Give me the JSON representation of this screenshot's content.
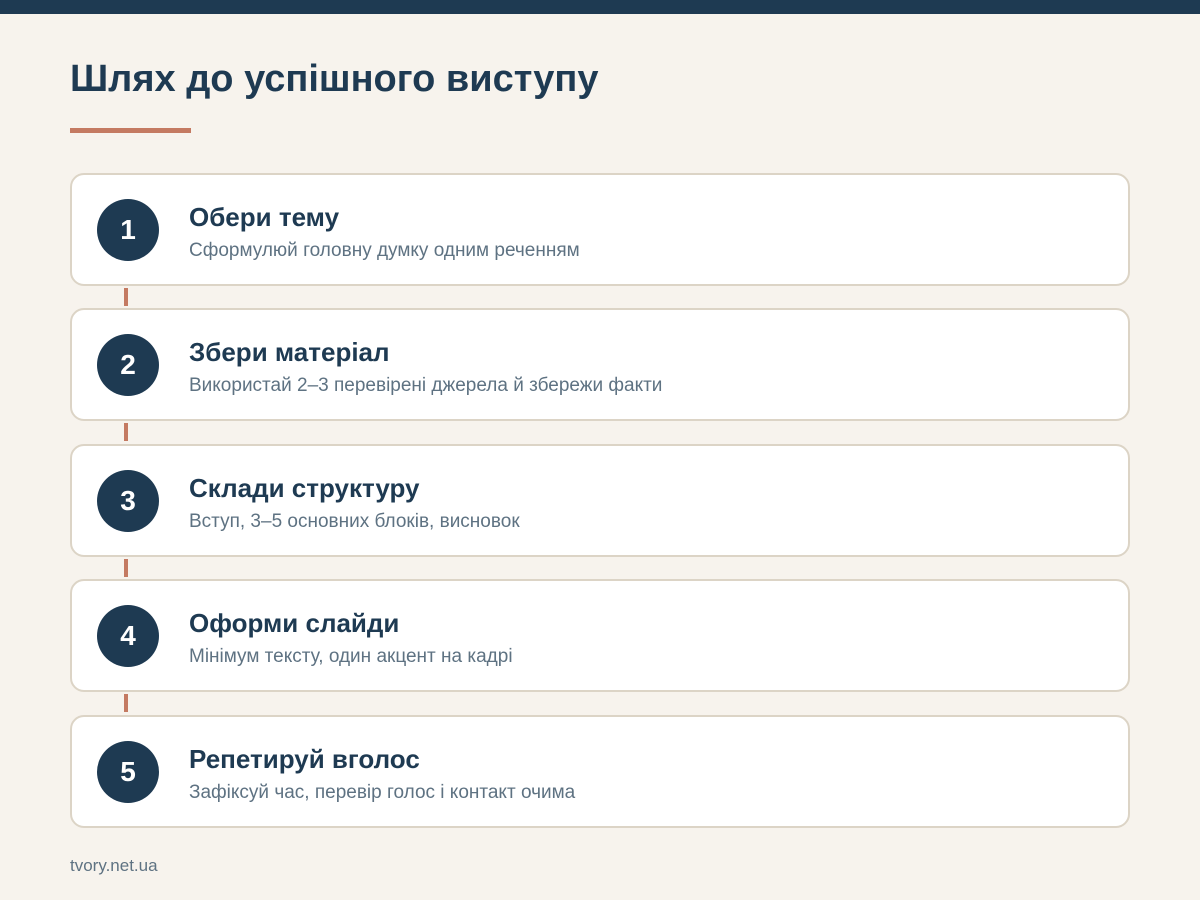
{
  "page": {
    "title": "Шлях до успішного виступу",
    "footer": "tvory.net.ua"
  },
  "colors": {
    "background": "#f7f3ed",
    "navy": "#1e3a52",
    "accent": "#c47a62",
    "muted_text": "#5e7282",
    "card_border": "#dcd4c6"
  },
  "steps": [
    {
      "number": "1",
      "title": "Обери тему",
      "description": "Сформулюй головну думку одним реченням"
    },
    {
      "number": "2",
      "title": "Збери матеріал",
      "description": "Використай 2–3 перевірені джерела й збережи факти"
    },
    {
      "number": "3",
      "title": "Склади структуру",
      "description": "Вступ, 3–5 основних блоків, висновок"
    },
    {
      "number": "4",
      "title": "Оформи слайди",
      "description": "Мінімум тексту, один акцент на кадрі"
    },
    {
      "number": "5",
      "title": "Репетируй вголос",
      "description": "Зафіксуй час, перевір голос і контакт очима"
    }
  ]
}
